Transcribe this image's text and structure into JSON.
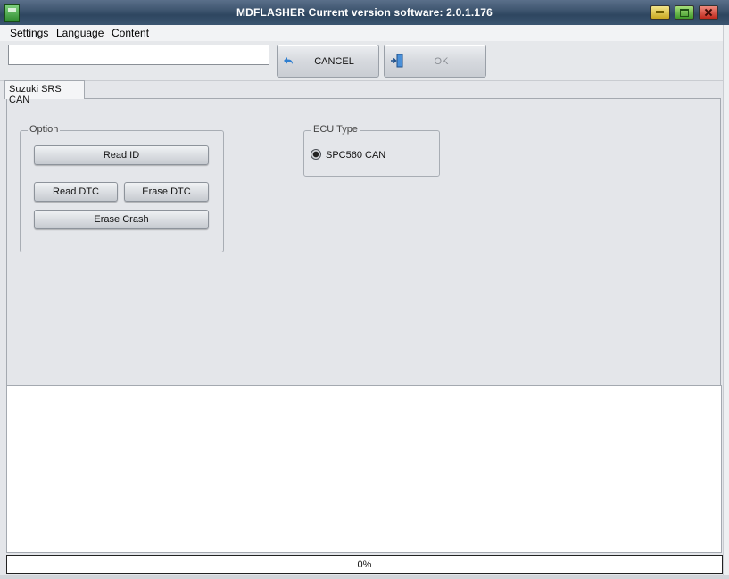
{
  "window": {
    "title": "MDFLASHER  Current version software: 2.0.1.176",
    "icon": "app-icon"
  },
  "menu": {
    "items": [
      "Settings",
      "Language",
      "Content"
    ]
  },
  "toolbar": {
    "input_value": "",
    "cancel_label": "CANCEL",
    "ok_label": "OK"
  },
  "tabs": [
    {
      "label": "Suzuki SRS CAN",
      "active": true
    }
  ],
  "option_group": {
    "title": "Option",
    "read_id": "Read ID",
    "read_dtc": "Read DTC",
    "erase_dtc": "Erase DTC",
    "erase_crash": "Erase Crash"
  },
  "ecu_group": {
    "title": "ECU Type",
    "options": [
      {
        "label": "SPC560  CAN",
        "selected": true
      }
    ]
  },
  "log": {
    "text": ""
  },
  "progress": {
    "value": 0,
    "label": "0%"
  }
}
